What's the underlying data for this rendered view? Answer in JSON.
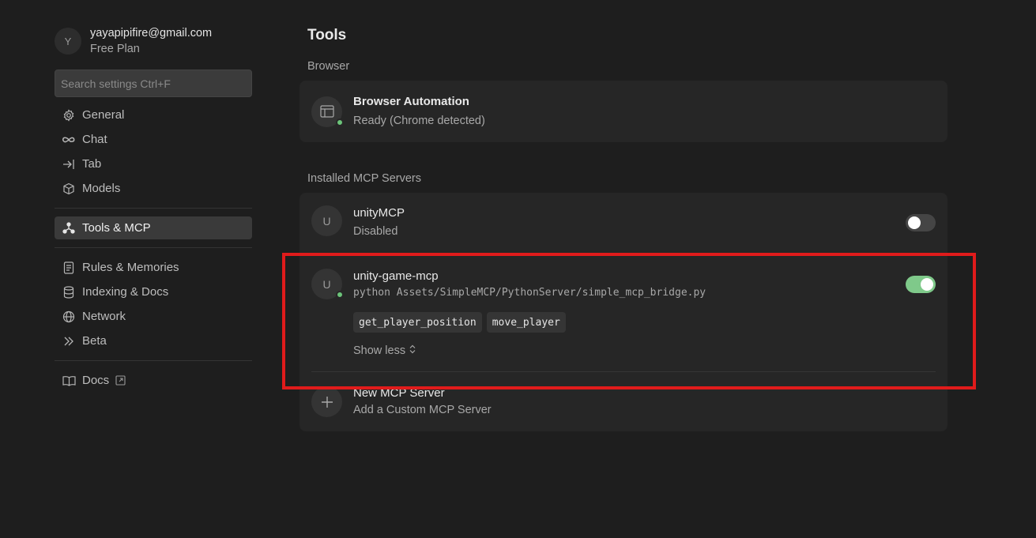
{
  "account": {
    "avatar_letter": "Y",
    "email": "yayapipifire@gmail.com",
    "plan": "Free Plan"
  },
  "search": {
    "placeholder": "Search settings Ctrl+F"
  },
  "nav": {
    "group1": [
      {
        "label": "General",
        "icon": "gear-icon"
      },
      {
        "label": "Chat",
        "icon": "infinity-icon"
      },
      {
        "label": "Tab",
        "icon": "arrow-right-to-line-icon"
      },
      {
        "label": "Models",
        "icon": "cube-icon"
      }
    ],
    "group2": [
      {
        "label": "Tools & MCP",
        "icon": "network-nodes-icon",
        "active": true
      }
    ],
    "group3": [
      {
        "label": "Rules & Memories",
        "icon": "document-icon"
      },
      {
        "label": "Indexing & Docs",
        "icon": "database-icon"
      },
      {
        "label": "Network",
        "icon": "globe-icon"
      },
      {
        "label": "Beta",
        "icon": "double-chevron-right-icon"
      }
    ],
    "group4": [
      {
        "label": "Docs",
        "icon": "book-icon",
        "external": true
      }
    ]
  },
  "main": {
    "title": "Tools",
    "browser_section": "Browser",
    "browser": {
      "title": "Browser Automation",
      "status": "Ready (Chrome detected)"
    },
    "mcp_section": "Installed MCP Servers",
    "servers": [
      {
        "letter": "U",
        "name": "unityMCP",
        "status": "Disabled",
        "enabled": false
      },
      {
        "letter": "U",
        "name": "unity-game-mcp",
        "command": "python Assets/SimpleMCP/PythonServer/simple_mcp_bridge.py",
        "enabled": true,
        "tools": [
          "get_player_position",
          "move_player"
        ],
        "show_less": "Show less"
      }
    ],
    "new_server": {
      "title": "New MCP Server",
      "subtitle": "Add a Custom MCP Server"
    }
  },
  "colors": {
    "background": "#1e1e1e",
    "card": "#262626",
    "toggle_on": "#7fc98a",
    "status_green": "#6cc47a",
    "highlight": "#e01b1b"
  }
}
